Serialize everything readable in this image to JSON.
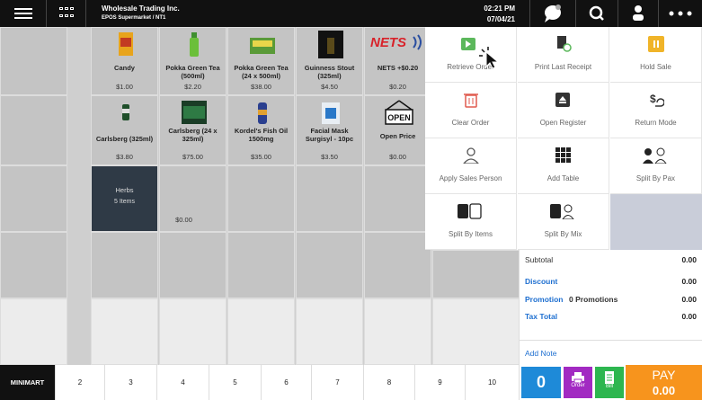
{
  "header": {
    "company": "Wholesale Trading Inc.",
    "store": "EPOS Supermarket / NT1",
    "time": "02:21 PM",
    "date": "07/04/21"
  },
  "products": [
    {
      "name": "Candy",
      "price": "$1.00"
    },
    {
      "name": "Pokka Green Tea (500ml)",
      "price": "$2.20"
    },
    {
      "name": "Pokka Green Tea (24 x 500ml)",
      "price": "$38.00"
    },
    {
      "name": "Guinness Stout (325ml)",
      "price": "$4.50"
    },
    {
      "name": "NETS +$0.20",
      "price": "$0.20"
    },
    {
      "name": "Carlsberg (325ml)",
      "price": "$3.80"
    },
    {
      "name": "Carlsberg (24 x 325ml)",
      "price": "$75.00"
    },
    {
      "name": "Kordel's Fish Oil 1500mg",
      "price": "$35.00"
    },
    {
      "name": "Facial Mask Surgisyl - 10pc",
      "price": "$3.50"
    },
    {
      "name": "Open Price",
      "price": "$0.00"
    }
  ],
  "category": {
    "name": "Herbs",
    "count": "5 Items"
  },
  "misc_price": "$0.00",
  "logo_text": {
    "nets": "NETS",
    "open": "OPEN"
  },
  "menu": [
    "Retrieve Order",
    "Print Last Receipt",
    "Hold Sale",
    "Clear Order",
    "Open Register",
    "Return Mode",
    "Apply Sales Person",
    "Add Table",
    "Split By Pax",
    "Split By Items",
    "Split By Mix"
  ],
  "summary": {
    "subtotal_label": "Subtotal",
    "subtotal": "0.00",
    "discount_label": "Discount",
    "discount": "0.00",
    "promotion_label": "Promotion",
    "promotion_text": "0 Promotions",
    "promotion": "0.00",
    "tax_label": "Tax Total",
    "tax": "0.00",
    "add_note": "Add Note"
  },
  "tabs": [
    "MINIMART",
    "2",
    "3",
    "4",
    "5",
    "6",
    "7",
    "8",
    "9",
    "10"
  ],
  "footer": {
    "count": "0",
    "order": "Order",
    "bill": "Bill",
    "pay": "PAY",
    "pay_total": "0.00"
  },
  "colors": {
    "accent_blue": "#1e8ad8",
    "order": "#a22ac2",
    "bill": "#2db64f",
    "pay": "#f7941d",
    "discount": "#1e6fd0"
  }
}
